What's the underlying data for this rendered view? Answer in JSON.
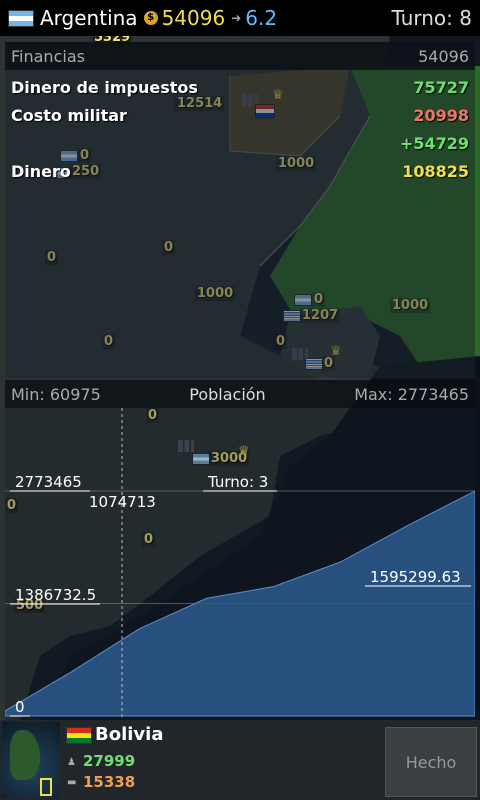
{
  "topbar": {
    "country": "Argentina",
    "money": "54096",
    "rate": "6.2",
    "turn": "Turno: 8"
  },
  "finance": {
    "title": "Financias",
    "total": "54096",
    "rows": [
      {
        "label": "Dinero de impuestos",
        "value": "75727"
      },
      {
        "label": "Costo militar",
        "value": "20998"
      },
      {
        "label": "",
        "value": "+54729"
      },
      {
        "label": "Dinero",
        "value": "108825"
      }
    ]
  },
  "map_labels": [
    "5329",
    "12514",
    "1000",
    "0",
    "250",
    "0",
    "0",
    "1000",
    "0",
    "1207",
    "0",
    "0",
    "1000",
    "0",
    "0",
    "3000",
    "0",
    "0",
    "500"
  ],
  "population": {
    "min_label": "Min: 60975",
    "title": "Población",
    "max_label": "Max: 2773465",
    "turn_label": "Turno: 3",
    "tick_labels": [
      "2773465",
      "1386732.5",
      "0"
    ],
    "hover_value": "1074713",
    "point_label": "1595299.63"
  },
  "chart_data": {
    "type": "area",
    "x": [
      1,
      2,
      3,
      4,
      5,
      6,
      7,
      8
    ],
    "values": [
      60975,
      550000,
      1074713,
      1450000,
      1595299.63,
      1900000,
      2350000,
      2773465
    ],
    "ylim": [
      0,
      2773465
    ],
    "title": "Población",
    "xlabel": "",
    "ylabel": "",
    "grid": true,
    "color": "#2d5b8f"
  },
  "bottom": {
    "country": "Bolivia",
    "stat1": "27999",
    "stat2": "15338",
    "done_button": "Hecho"
  },
  "colors": {
    "accent_yellow": "#f2dd4a",
    "positive": "#6fe06f",
    "negative": "#f0746a",
    "rate_blue": "#5bc0ff"
  }
}
